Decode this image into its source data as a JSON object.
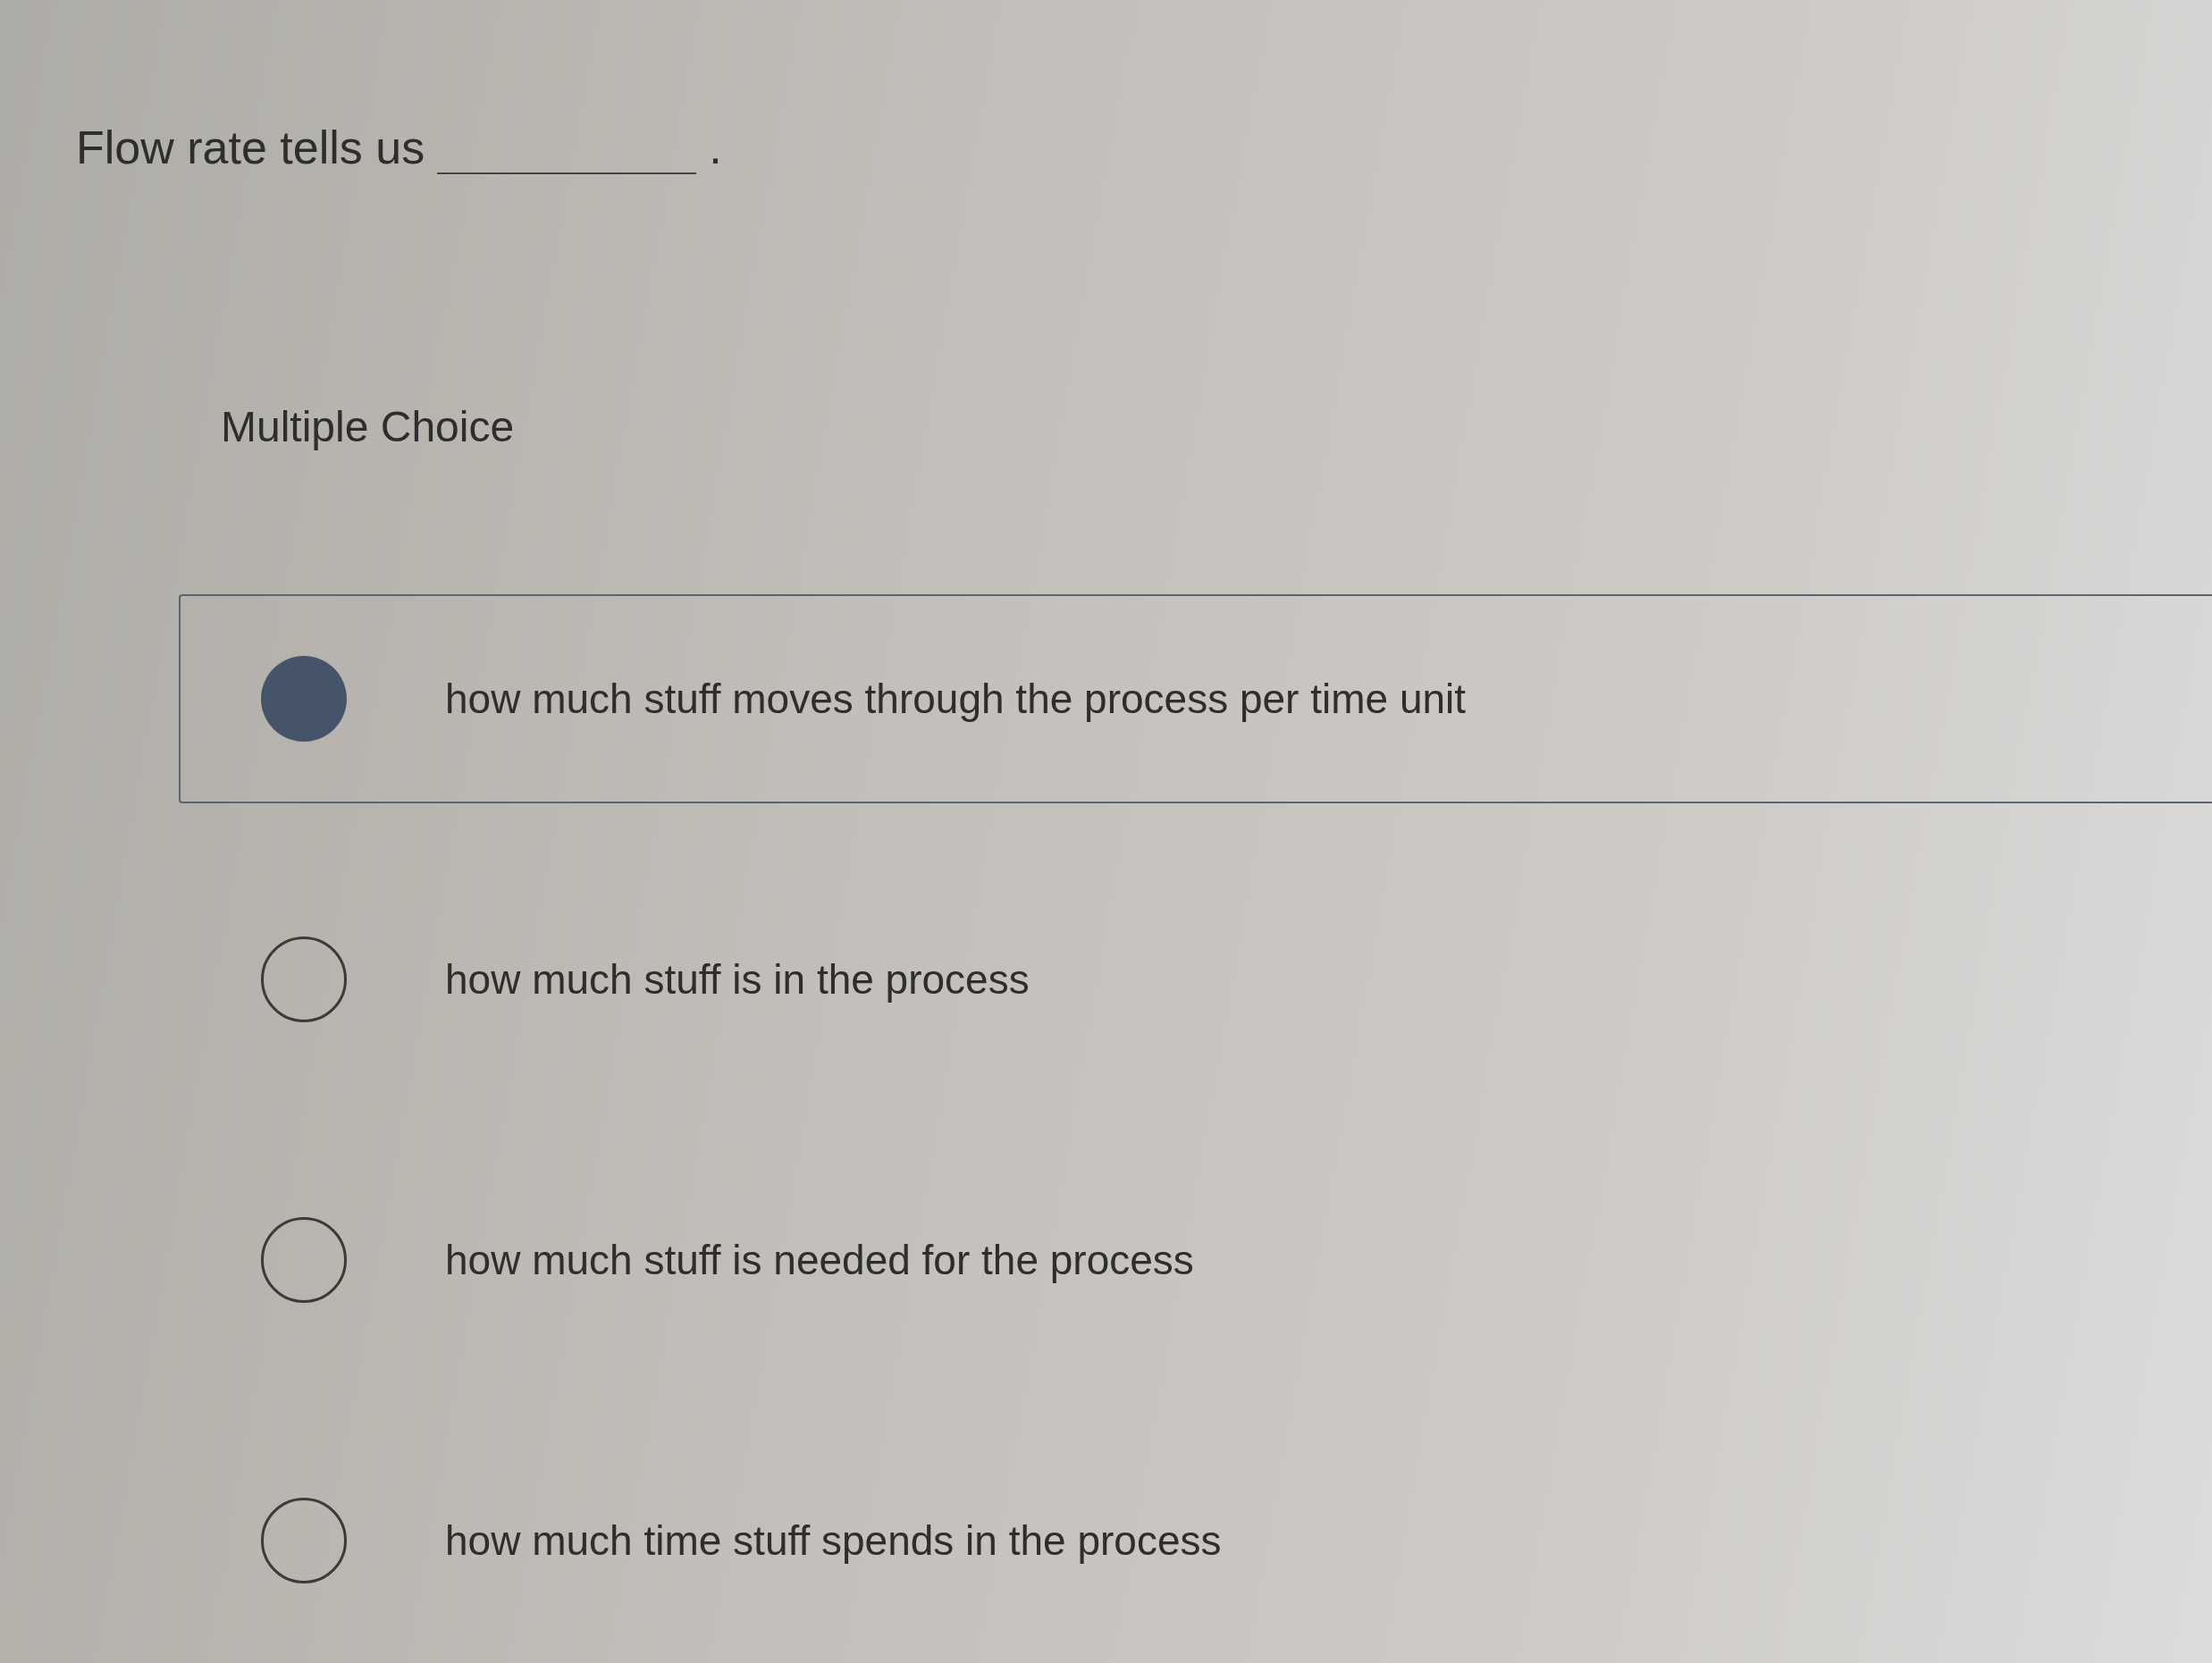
{
  "question": {
    "text": "Flow rate tells us",
    "blank_end": "."
  },
  "section_label": "Multiple Choice",
  "options": [
    {
      "label": "how much stuff moves through the process per time unit",
      "selected": true
    },
    {
      "label": "how much stuff is in the process",
      "selected": false
    },
    {
      "label": "how much stuff is needed for the process",
      "selected": false
    },
    {
      "label": "how much time stuff spends in the process",
      "selected": false
    }
  ]
}
